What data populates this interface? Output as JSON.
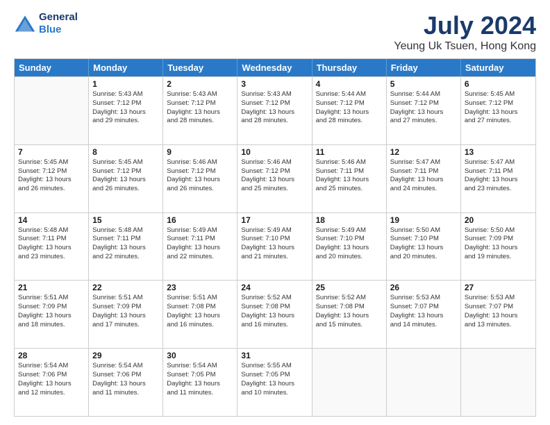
{
  "logo": {
    "line1": "General",
    "line2": "Blue"
  },
  "title": "July 2024",
  "subtitle": "Yeung Uk Tsuen, Hong Kong",
  "headers": [
    "Sunday",
    "Monday",
    "Tuesday",
    "Wednesday",
    "Thursday",
    "Friday",
    "Saturday"
  ],
  "weeks": [
    [
      {
        "day": "",
        "lines": []
      },
      {
        "day": "1",
        "lines": [
          "Sunrise: 5:43 AM",
          "Sunset: 7:12 PM",
          "Daylight: 13 hours",
          "and 29 minutes."
        ]
      },
      {
        "day": "2",
        "lines": [
          "Sunrise: 5:43 AM",
          "Sunset: 7:12 PM",
          "Daylight: 13 hours",
          "and 28 minutes."
        ]
      },
      {
        "day": "3",
        "lines": [
          "Sunrise: 5:43 AM",
          "Sunset: 7:12 PM",
          "Daylight: 13 hours",
          "and 28 minutes."
        ]
      },
      {
        "day": "4",
        "lines": [
          "Sunrise: 5:44 AM",
          "Sunset: 7:12 PM",
          "Daylight: 13 hours",
          "and 28 minutes."
        ]
      },
      {
        "day": "5",
        "lines": [
          "Sunrise: 5:44 AM",
          "Sunset: 7:12 PM",
          "Daylight: 13 hours",
          "and 27 minutes."
        ]
      },
      {
        "day": "6",
        "lines": [
          "Sunrise: 5:45 AM",
          "Sunset: 7:12 PM",
          "Daylight: 13 hours",
          "and 27 minutes."
        ]
      }
    ],
    [
      {
        "day": "7",
        "lines": [
          "Sunrise: 5:45 AM",
          "Sunset: 7:12 PM",
          "Daylight: 13 hours",
          "and 26 minutes."
        ]
      },
      {
        "day": "8",
        "lines": [
          "Sunrise: 5:45 AM",
          "Sunset: 7:12 PM",
          "Daylight: 13 hours",
          "and 26 minutes."
        ]
      },
      {
        "day": "9",
        "lines": [
          "Sunrise: 5:46 AM",
          "Sunset: 7:12 PM",
          "Daylight: 13 hours",
          "and 26 minutes."
        ]
      },
      {
        "day": "10",
        "lines": [
          "Sunrise: 5:46 AM",
          "Sunset: 7:12 PM",
          "Daylight: 13 hours",
          "and 25 minutes."
        ]
      },
      {
        "day": "11",
        "lines": [
          "Sunrise: 5:46 AM",
          "Sunset: 7:11 PM",
          "Daylight: 13 hours",
          "and 25 minutes."
        ]
      },
      {
        "day": "12",
        "lines": [
          "Sunrise: 5:47 AM",
          "Sunset: 7:11 PM",
          "Daylight: 13 hours",
          "and 24 minutes."
        ]
      },
      {
        "day": "13",
        "lines": [
          "Sunrise: 5:47 AM",
          "Sunset: 7:11 PM",
          "Daylight: 13 hours",
          "and 23 minutes."
        ]
      }
    ],
    [
      {
        "day": "14",
        "lines": [
          "Sunrise: 5:48 AM",
          "Sunset: 7:11 PM",
          "Daylight: 13 hours",
          "and 23 minutes."
        ]
      },
      {
        "day": "15",
        "lines": [
          "Sunrise: 5:48 AM",
          "Sunset: 7:11 PM",
          "Daylight: 13 hours",
          "and 22 minutes."
        ]
      },
      {
        "day": "16",
        "lines": [
          "Sunrise: 5:49 AM",
          "Sunset: 7:11 PM",
          "Daylight: 13 hours",
          "and 22 minutes."
        ]
      },
      {
        "day": "17",
        "lines": [
          "Sunrise: 5:49 AM",
          "Sunset: 7:10 PM",
          "Daylight: 13 hours",
          "and 21 minutes."
        ]
      },
      {
        "day": "18",
        "lines": [
          "Sunrise: 5:49 AM",
          "Sunset: 7:10 PM",
          "Daylight: 13 hours",
          "and 20 minutes."
        ]
      },
      {
        "day": "19",
        "lines": [
          "Sunrise: 5:50 AM",
          "Sunset: 7:10 PM",
          "Daylight: 13 hours",
          "and 20 minutes."
        ]
      },
      {
        "day": "20",
        "lines": [
          "Sunrise: 5:50 AM",
          "Sunset: 7:09 PM",
          "Daylight: 13 hours",
          "and 19 minutes."
        ]
      }
    ],
    [
      {
        "day": "21",
        "lines": [
          "Sunrise: 5:51 AM",
          "Sunset: 7:09 PM",
          "Daylight: 13 hours",
          "and 18 minutes."
        ]
      },
      {
        "day": "22",
        "lines": [
          "Sunrise: 5:51 AM",
          "Sunset: 7:09 PM",
          "Daylight: 13 hours",
          "and 17 minutes."
        ]
      },
      {
        "day": "23",
        "lines": [
          "Sunrise: 5:51 AM",
          "Sunset: 7:08 PM",
          "Daylight: 13 hours",
          "and 16 minutes."
        ]
      },
      {
        "day": "24",
        "lines": [
          "Sunrise: 5:52 AM",
          "Sunset: 7:08 PM",
          "Daylight: 13 hours",
          "and 16 minutes."
        ]
      },
      {
        "day": "25",
        "lines": [
          "Sunrise: 5:52 AM",
          "Sunset: 7:08 PM",
          "Daylight: 13 hours",
          "and 15 minutes."
        ]
      },
      {
        "day": "26",
        "lines": [
          "Sunrise: 5:53 AM",
          "Sunset: 7:07 PM",
          "Daylight: 13 hours",
          "and 14 minutes."
        ]
      },
      {
        "day": "27",
        "lines": [
          "Sunrise: 5:53 AM",
          "Sunset: 7:07 PM",
          "Daylight: 13 hours",
          "and 13 minutes."
        ]
      }
    ],
    [
      {
        "day": "28",
        "lines": [
          "Sunrise: 5:54 AM",
          "Sunset: 7:06 PM",
          "Daylight: 13 hours",
          "and 12 minutes."
        ]
      },
      {
        "day": "29",
        "lines": [
          "Sunrise: 5:54 AM",
          "Sunset: 7:06 PM",
          "Daylight: 13 hours",
          "and 11 minutes."
        ]
      },
      {
        "day": "30",
        "lines": [
          "Sunrise: 5:54 AM",
          "Sunset: 7:05 PM",
          "Daylight: 13 hours",
          "and 11 minutes."
        ]
      },
      {
        "day": "31",
        "lines": [
          "Sunrise: 5:55 AM",
          "Sunset: 7:05 PM",
          "Daylight: 13 hours",
          "and 10 minutes."
        ]
      },
      {
        "day": "",
        "lines": []
      },
      {
        "day": "",
        "lines": []
      },
      {
        "day": "",
        "lines": []
      }
    ]
  ]
}
